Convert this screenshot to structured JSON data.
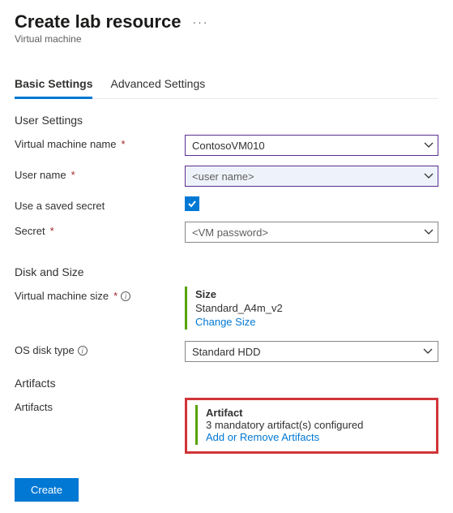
{
  "header": {
    "title": "Create lab resource",
    "subtitle": "Virtual machine"
  },
  "tabs": {
    "basic": "Basic Settings",
    "advanced": "Advanced Settings"
  },
  "sections": {
    "user_settings": "User Settings",
    "disk_and_size": "Disk and Size",
    "artifacts": "Artifacts"
  },
  "labels": {
    "vm_name": "Virtual machine name",
    "user_name": "User name",
    "use_saved_secret": "Use a saved secret",
    "secret": "Secret",
    "vm_size": "Virtual machine size",
    "os_disk_type": "OS disk type",
    "artifacts": "Artifacts"
  },
  "fields": {
    "vm_name_value": "ContosoVM010",
    "user_name_placeholder": "<user name>",
    "secret_placeholder": "<VM password>",
    "use_saved_secret_checked": true
  },
  "size": {
    "header": "Size",
    "value": "Standard_A4m_v2",
    "change_link": "Change Size"
  },
  "os_disk": {
    "selected": "Standard HDD"
  },
  "artifacts_block": {
    "header": "Artifact",
    "status": "3 mandatory artifact(s) configured",
    "link": "Add or Remove Artifacts"
  },
  "buttons": {
    "create": "Create"
  }
}
